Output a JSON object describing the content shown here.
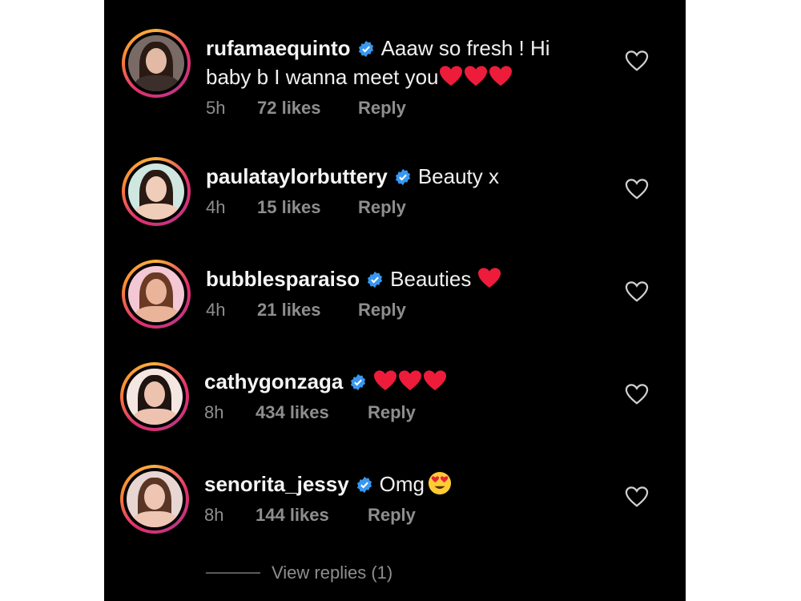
{
  "comments": [
    {
      "username": "rufamaequinto",
      "text_line1": "Aaaw so fresh ! Hi",
      "text_line2": "baby b I wanna meet you",
      "hearts": 3,
      "time": "5h",
      "likes": "72 likes",
      "reply": "Reply",
      "avatar_colors": {
        "bg": "#7a6a66",
        "hair": "#2b1d18",
        "skin": "#e2b9a4"
      }
    },
    {
      "username": "paulataylorbuttery",
      "text": "Beauty x",
      "time": "4h",
      "likes": "15 likes",
      "reply": "Reply",
      "avatar_colors": {
        "bg": "#cfe7e0",
        "hair": "#2a1a14",
        "skin": "#f0cdb8"
      }
    },
    {
      "username": "bubblesparaiso",
      "text": "Beauties",
      "hearts": 1,
      "time": "4h",
      "likes": "21 likes",
      "reply": "Reply",
      "avatar_colors": {
        "bg": "#f3c7d3",
        "hair": "#6b3a24",
        "skin": "#e9b49a"
      }
    },
    {
      "username": "cathygonzaga",
      "text": "",
      "hearts": 3,
      "time": "8h",
      "likes": "434 likes",
      "reply": "Reply",
      "avatar_colors": {
        "bg": "#f4e7e2",
        "hair": "#1e1410",
        "skin": "#edc3b0"
      }
    },
    {
      "username": "senorita_jessy",
      "text": "Omg",
      "emoji": "heart-eyes",
      "time": "8h",
      "likes": "144 likes",
      "reply": "Reply",
      "avatar_colors": {
        "bg": "#e8d6d2",
        "hair": "#5a3526",
        "skin": "#efc6b3"
      }
    }
  ],
  "view_replies": "View replies (1)",
  "colors": {
    "background": "#000000",
    "text": "#f0f0f0",
    "meta": "#8e8e8e",
    "verified": "#3897f0",
    "heart": "#ed4956"
  }
}
